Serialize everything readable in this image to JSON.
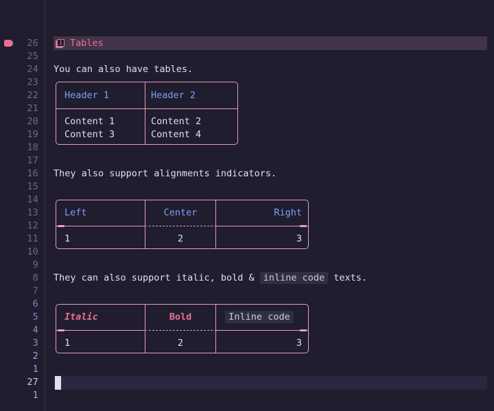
{
  "editor": {
    "theme_bg": "#1f1d2e",
    "accent_pink": "#eb6f92",
    "table_border": "#e8a0bd",
    "header_blue": "#7aa2f7",
    "text": "#e0def4"
  },
  "gutter": {
    "sign_marker": "heading-marker",
    "lines": [
      {
        "num": "26",
        "style": "far"
      },
      {
        "num": "25",
        "style": "far"
      },
      {
        "num": "24",
        "style": "far"
      },
      {
        "num": "23",
        "style": "far"
      },
      {
        "num": "22",
        "style": "far"
      },
      {
        "num": "21",
        "style": "far"
      },
      {
        "num": "20",
        "style": "far"
      },
      {
        "num": "19",
        "style": "far"
      },
      {
        "num": "18",
        "style": "far"
      },
      {
        "num": "17",
        "style": "far"
      },
      {
        "num": "16",
        "style": "far"
      },
      {
        "num": "15",
        "style": "far"
      },
      {
        "num": "14",
        "style": "far"
      },
      {
        "num": "13",
        "style": "far"
      },
      {
        "num": "12",
        "style": "far"
      },
      {
        "num": "11",
        "style": "far"
      },
      {
        "num": "10",
        "style": "far"
      },
      {
        "num": "9",
        "style": "far"
      },
      {
        "num": "8",
        "style": "far"
      },
      {
        "num": "7",
        "style": "far"
      },
      {
        "num": "6",
        "style": "near3"
      },
      {
        "num": "5",
        "style": "near3"
      },
      {
        "num": "4",
        "style": "near2"
      },
      {
        "num": "3",
        "style": "near2"
      },
      {
        "num": "2",
        "style": "near1"
      },
      {
        "num": "1",
        "style": "near1"
      },
      {
        "num": "27",
        "style": "cur"
      },
      {
        "num": "1",
        "style": "near1"
      }
    ]
  },
  "document": {
    "heading": {
      "level_icon": "h1-icon",
      "level_label": "1",
      "text": "Tables"
    },
    "paragraph_1": "You can also have tables.",
    "paragraph_2": "They also support alignments indicators.",
    "paragraph_3": {
      "before": "They can also support italic, bold & ",
      "code": "inline code",
      "after": " texts."
    },
    "tables": [
      {
        "name": "basic-table",
        "headers": [
          "Header 1",
          "Header 2"
        ],
        "rows": [
          [
            "Content 1",
            "Content 2"
          ],
          [
            "Content 3",
            "Content 4"
          ]
        ],
        "alignments": [
          "left",
          "left"
        ]
      },
      {
        "name": "alignment-table",
        "headers": [
          "Left",
          "Center",
          "Right"
        ],
        "rows": [
          [
            "1",
            "2",
            "3"
          ]
        ],
        "alignments": [
          "left",
          "center",
          "right"
        ]
      },
      {
        "name": "formatting-table",
        "headers": [
          "Italic",
          "Bold",
          "Inline code"
        ],
        "header_styles": [
          "italic",
          "bold",
          "code"
        ],
        "rows": [
          [
            "1",
            "2",
            "3"
          ]
        ],
        "alignments": [
          "left",
          "center",
          "right"
        ]
      }
    ]
  },
  "cursor": {
    "line": "27",
    "column": "1"
  }
}
